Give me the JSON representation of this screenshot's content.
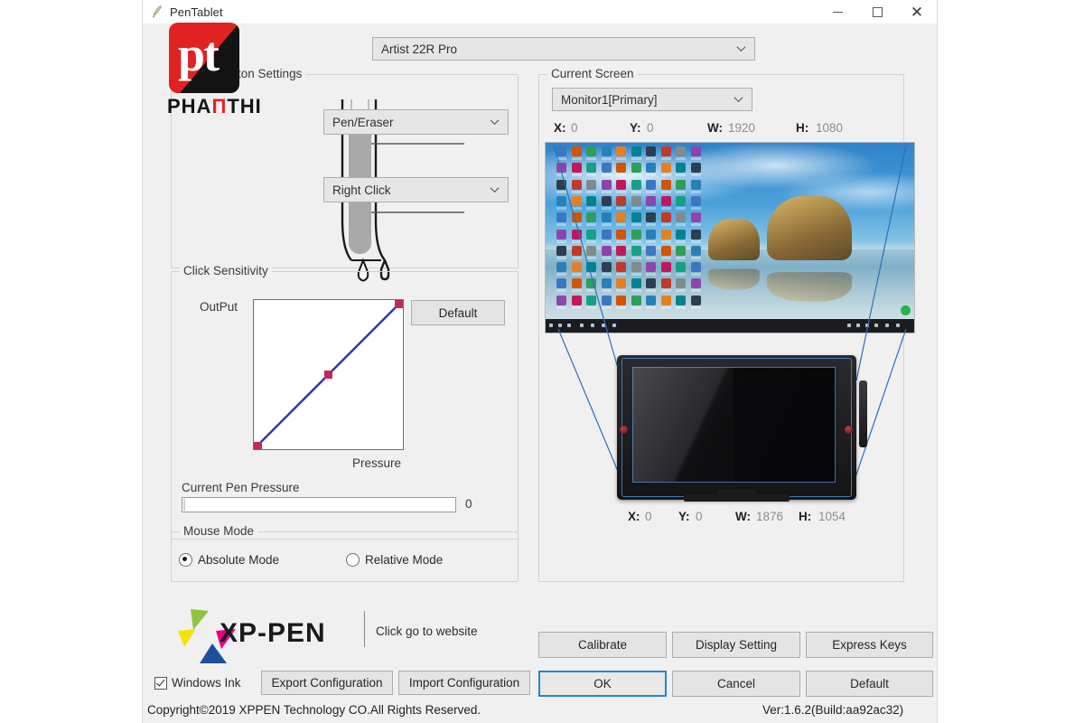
{
  "window": {
    "title": "PenTablet",
    "icon": "pen-tablet-icon",
    "controls": {
      "minimize": "minimize",
      "maximize": "maximize",
      "close": "close"
    }
  },
  "device_selector": {
    "value": "Artist 22R Pro",
    "icon": "chevron-down-icon"
  },
  "barrel_button_settings": {
    "title": "Barrel Button Settings",
    "top_button": {
      "value": "Pen/Eraser",
      "icon": "chevron-down-icon"
    },
    "bottom_button": {
      "value": "Right Click",
      "icon": "chevron-down-icon"
    }
  },
  "click_sensitivity": {
    "title": "Click Sensitivity",
    "y_axis_label": "OutPut",
    "x_axis_label": "Pressure",
    "default_button": "Default",
    "pressure_label": "Current Pen Pressure",
    "pressure_value": "0",
    "curve_color": "#3333aa",
    "node_color": "#c02a5a"
  },
  "mouse_mode": {
    "title": "Mouse Mode",
    "options": [
      {
        "label": "Absolute Mode",
        "selected": true
      },
      {
        "label": "Relative Mode",
        "selected": false
      }
    ]
  },
  "current_screen": {
    "title": "Current Screen",
    "monitor": {
      "value": "Monitor1[Primary]",
      "icon": "chevron-down-icon"
    },
    "screen_metrics": [
      {
        "key": "X:",
        "value": "0"
      },
      {
        "key": "Y:",
        "value": "0"
      },
      {
        "key": "W:",
        "value": "1920"
      },
      {
        "key": "H:",
        "value": "1080"
      }
    ],
    "tablet_metrics": [
      {
        "key": "X:",
        "value": "0"
      },
      {
        "key": "Y:",
        "value": "0"
      },
      {
        "key": "W:",
        "value": "1876"
      },
      {
        "key": "H:",
        "value": "1054"
      }
    ]
  },
  "branding": {
    "logo_text": "XP-PEN",
    "website_text": "Click go to website",
    "copyright": "Copyright©2019  XPPEN Technology CO.All Rights Reserved.",
    "version": "Ver:1.6.2(Build:aa92ac32)",
    "accent_colors": {
      "green": "#8cc63f",
      "yellow": "#f5e300",
      "magenta": "#e6007e",
      "blue": "#1d4f9c",
      "red": "#e02322"
    }
  },
  "footer": {
    "windows_ink": {
      "label": "Windows Ink",
      "checked": true
    },
    "export_button": "Export Configuration",
    "import_button": "Import Configuration",
    "calibrate_button": "Calibrate",
    "display_setting_button": "Display Setting",
    "express_keys_button": "Express Keys",
    "ok_button": "OK",
    "cancel_button": "Cancel",
    "default_button": "Default"
  },
  "watermark": {
    "mark": "pt",
    "name_part1": "PHA",
    "name_accent": "Π",
    "name_part2": "THI"
  }
}
